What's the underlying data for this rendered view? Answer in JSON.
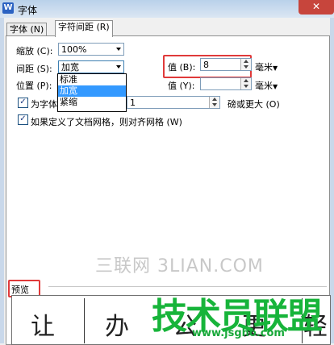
{
  "window": {
    "title": "字体",
    "logo": "W",
    "close": "✕"
  },
  "tabs": [
    {
      "label": "字体 (N)"
    },
    {
      "label": "字符间距 (R)"
    }
  ],
  "scale": {
    "label": "缩放 (C):",
    "value": "100%"
  },
  "spacing": {
    "label": "间距 (S):",
    "value": "加宽",
    "options": [
      "标准",
      "加宽",
      "紧缩"
    ]
  },
  "spacing_value": {
    "label": "值 (B):",
    "value": "8",
    "unit": "毫米"
  },
  "position": {
    "label": "位置 (P):"
  },
  "position_value": {
    "label": "值 (Y):",
    "value": "",
    "unit": "毫米"
  },
  "kerning": {
    "label": "为字体",
    "value": "1",
    "suffix": "磅或更大 (O)",
    "checked": "✓"
  },
  "grid": {
    "label": "如果定义了文档网格，则对齐网格 (W)",
    "checked": "✓"
  },
  "preview": {
    "label": "预览",
    "chars": [
      "让",
      "办",
      "公",
      "更",
      "轻"
    ]
  },
  "watermarks": {
    "text1": "三联网 3LIAN.COM",
    "logo": "技术员联盟",
    "url": "www.jsgho.com"
  }
}
